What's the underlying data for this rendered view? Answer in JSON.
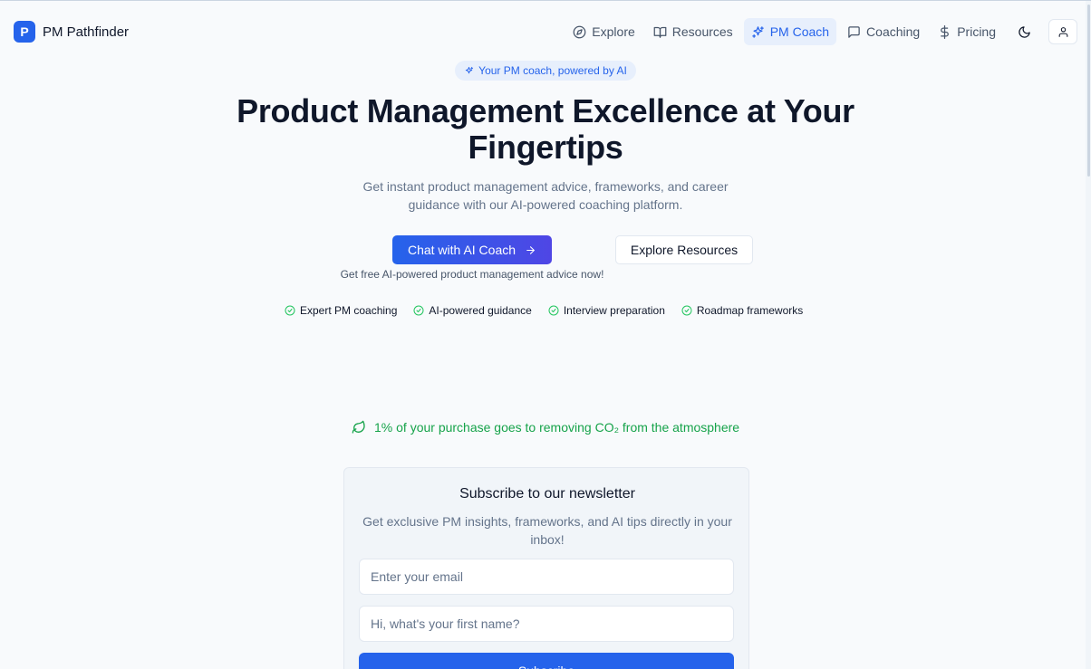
{
  "brand": {
    "logo_letter": "P",
    "name": "PM Pathfinder"
  },
  "nav": {
    "items": [
      {
        "label": "Explore",
        "icon": "compass-icon",
        "active": false
      },
      {
        "label": "Resources",
        "icon": "book-open-icon",
        "active": false
      },
      {
        "label": "PM Coach",
        "icon": "sparkles-icon",
        "active": true
      },
      {
        "label": "Coaching",
        "icon": "message-square-icon",
        "active": false
      },
      {
        "label": "Pricing",
        "icon": "dollar-sign-icon",
        "active": false
      }
    ],
    "theme_icon": "moon-icon",
    "user_icon": "user-icon"
  },
  "hero": {
    "badge": "Your PM coach, powered by AI",
    "title": "Product Management Excellence at Your Fingertips",
    "subtitle": "Get instant product management advice, frameworks, and career guidance with our AI-powered coaching platform.",
    "primary_cta": "Chat with AI Coach",
    "secondary_cta": "Explore Resources",
    "cta_note": "Get free AI-powered product management advice now!",
    "features": [
      "Expert PM coaching",
      "AI-powered guidance",
      "Interview preparation",
      "Roadmap frameworks"
    ]
  },
  "eco_note": "1% of your purchase goes to removing CO₂ from the atmosphere",
  "newsletter": {
    "title": "Subscribe to our newsletter",
    "subtitle": "Get exclusive PM insights, frameworks, and AI tips directly in your inbox!",
    "email_placeholder": "Enter your email",
    "name_placeholder": "Hi, what's your first name?",
    "submit_label": "Subscribe"
  },
  "colors": {
    "accent": "#2563eb",
    "eco_green": "#16a34a",
    "check_green": "#22c55e",
    "background": "#f8fafc"
  }
}
